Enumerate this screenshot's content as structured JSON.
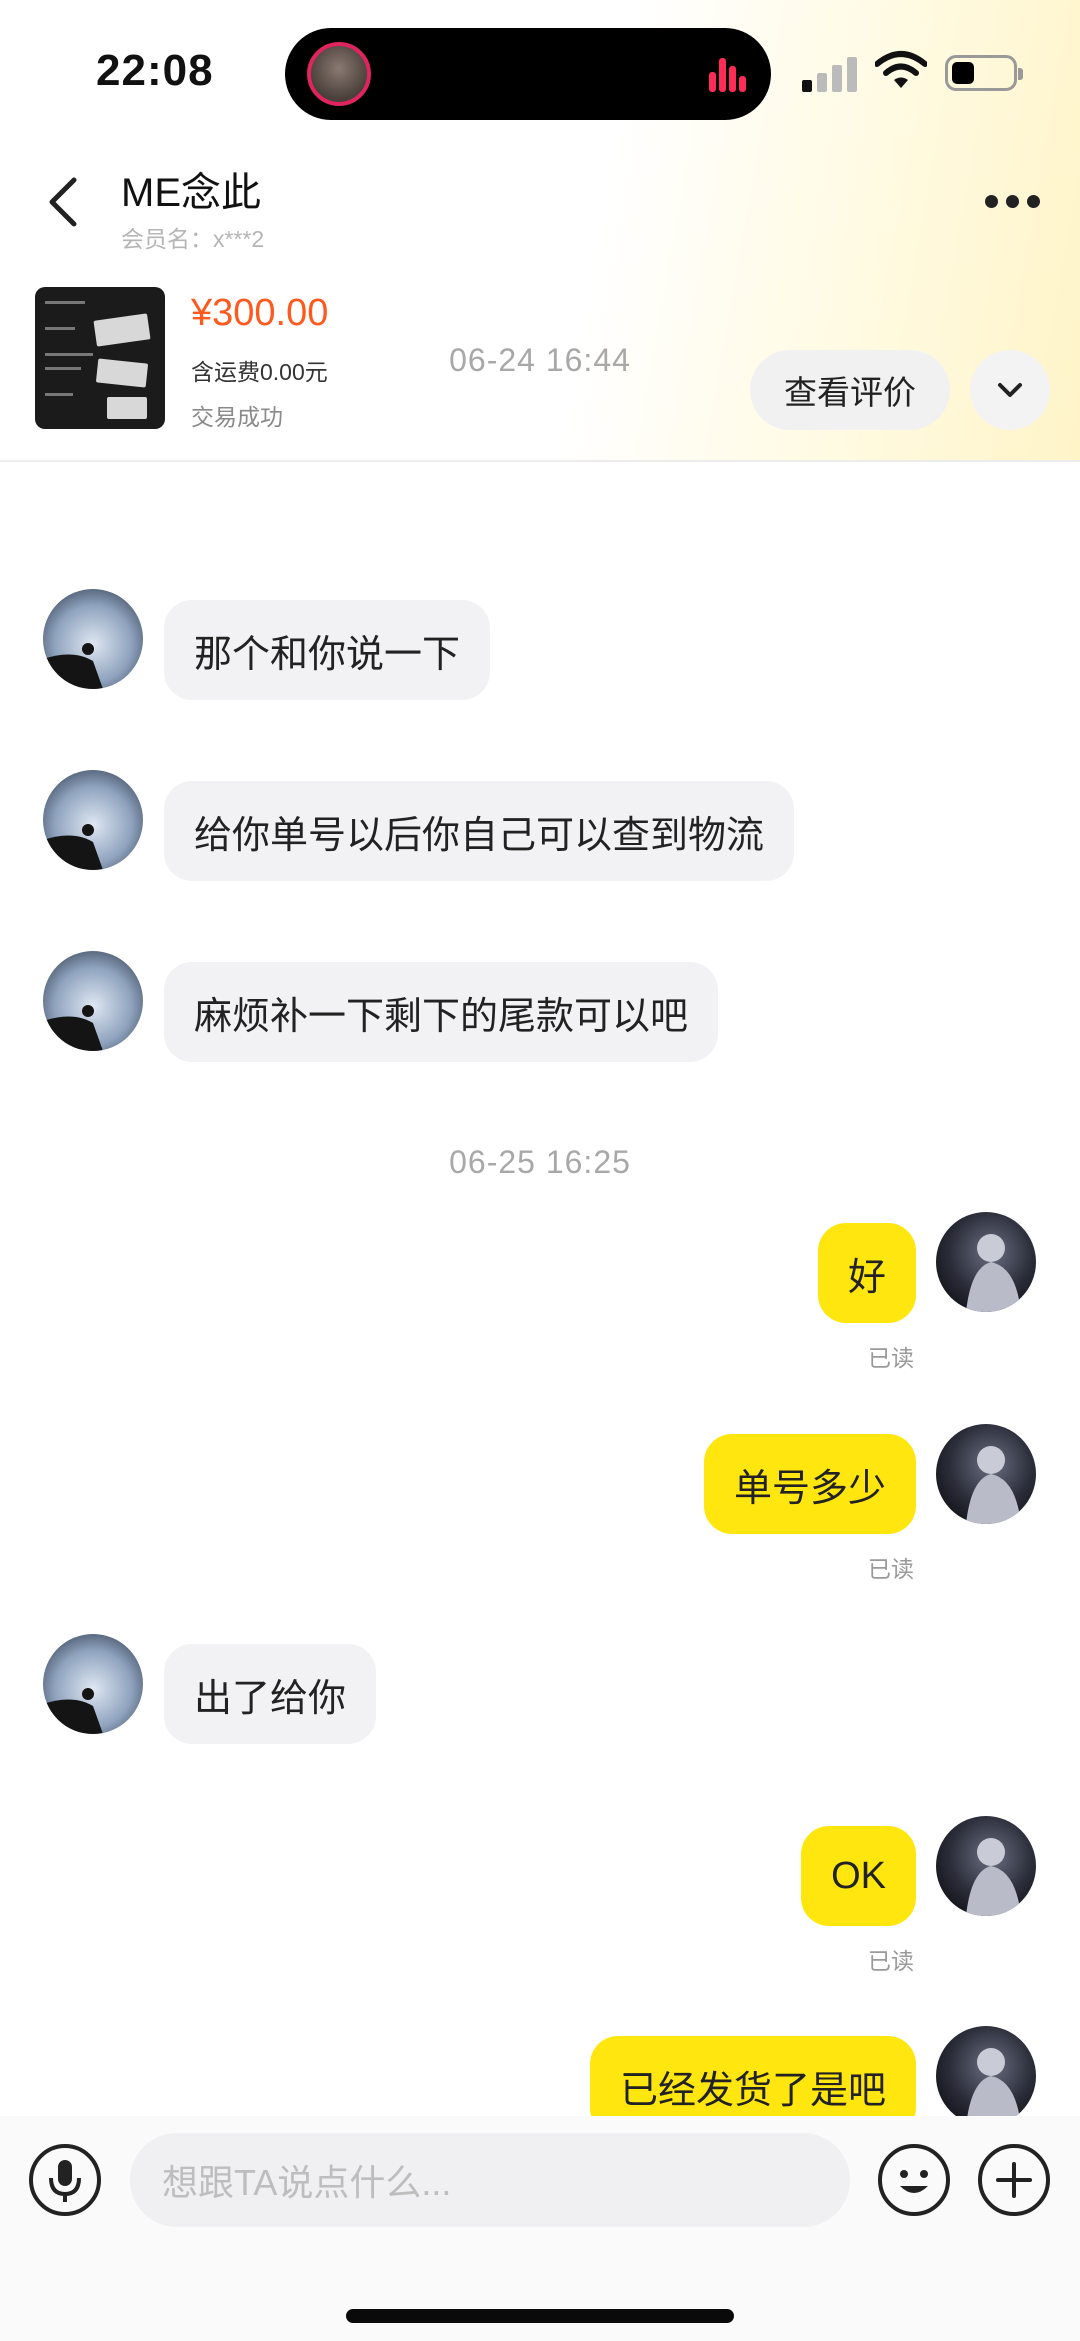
{
  "status_bar": {
    "time": "22:08"
  },
  "header": {
    "title": "ME念此",
    "subtitle": "会员名：x***2"
  },
  "product": {
    "price": "¥300.00",
    "shipping": "含运费0.00元",
    "status": "交易成功",
    "review_label": "查看评价"
  },
  "messages": {
    "ts1": "06-24 16:44",
    "m1": "那个和你说一下",
    "m2": "给你单号以后你自己可以查到物流",
    "m3": "麻烦补一下剩下的尾款可以吧",
    "ts2": "06-25 16:25",
    "m4": "好",
    "m4_read": "已读",
    "m5": "单号多少",
    "m5_read": "已读",
    "m6": "出了给你",
    "m7": "OK",
    "m7_read": "已读",
    "m8": "已经发货了是吧"
  },
  "input": {
    "placeholder": "想跟TA说点什么..."
  },
  "colors": {
    "accent_yellow": "#ffe60f",
    "price_orange": "#ff5a1e",
    "recording_pink": "#ff2d55"
  },
  "icons": [
    "back-icon",
    "more-icon",
    "chevron-down-icon",
    "microphone-icon",
    "emoji-icon",
    "plus-icon",
    "wifi-icon",
    "battery-icon",
    "signal-icon"
  ]
}
